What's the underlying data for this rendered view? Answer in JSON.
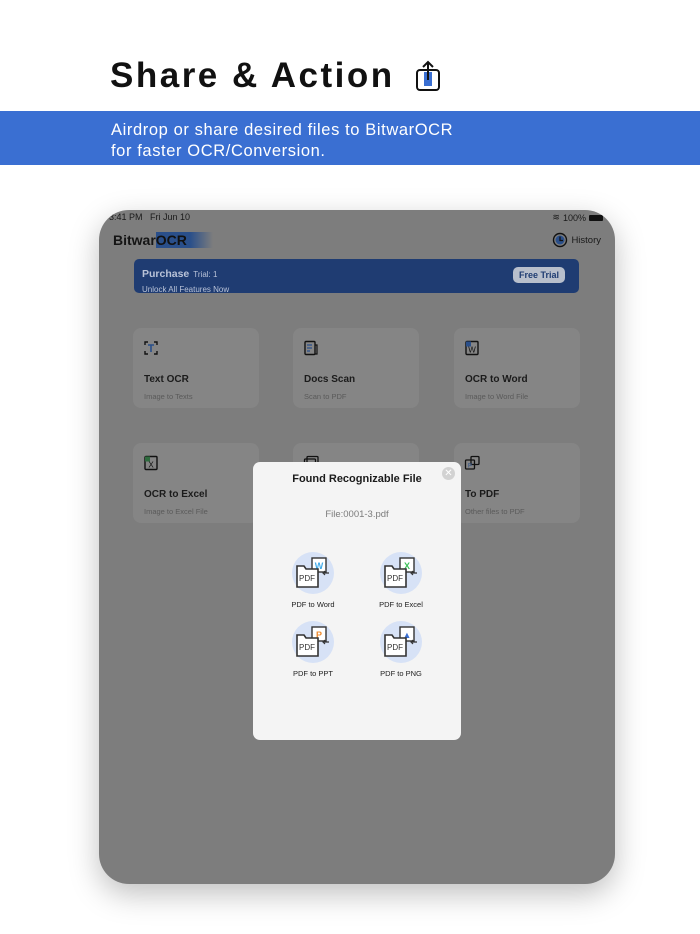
{
  "header": {
    "title": "Share & Action",
    "share_icon": "share-upload-icon"
  },
  "banner": {
    "line1": "Airdrop or share desired files to BitwarOCR",
    "line2": "for faster OCR/Conversion."
  },
  "device": {
    "status": {
      "time": "3:41 PM",
      "date": "Fri Jun 10",
      "battery": "100%"
    },
    "brand": {
      "prefix": "Bitwar",
      "suffix": "OCR"
    },
    "history_label": "History",
    "purchase": {
      "title": "Purchase",
      "trial": "Trial: 1",
      "subtitle": "Unlock All Features Now",
      "button": "Free Trial"
    },
    "cards": [
      {
        "title": "Text OCR",
        "subtitle": "Image to Texts"
      },
      {
        "title": "Docs Scan",
        "subtitle": "Scan to PDF"
      },
      {
        "title": "OCR to Word",
        "subtitle": "Image to Word File"
      },
      {
        "title": "OCR to Excel",
        "subtitle": "Image to Excel File"
      },
      {
        "title": "To PDF",
        "subtitle": "Other files to PDF"
      }
    ],
    "modal": {
      "title": "Found Recognizable File",
      "file": "File:0001-3.pdf",
      "options": [
        {
          "label": "PDF to Word",
          "badge": "W",
          "color": "#3fa9e8"
        },
        {
          "label": "PDF to Excel",
          "badge": "X",
          "color": "#3cc15a"
        },
        {
          "label": "PDF to PPT",
          "badge": "P",
          "color": "#f08a2c"
        },
        {
          "label": "PDF to PNG",
          "badge": "▲",
          "color": "#3a6fd2"
        }
      ]
    }
  }
}
